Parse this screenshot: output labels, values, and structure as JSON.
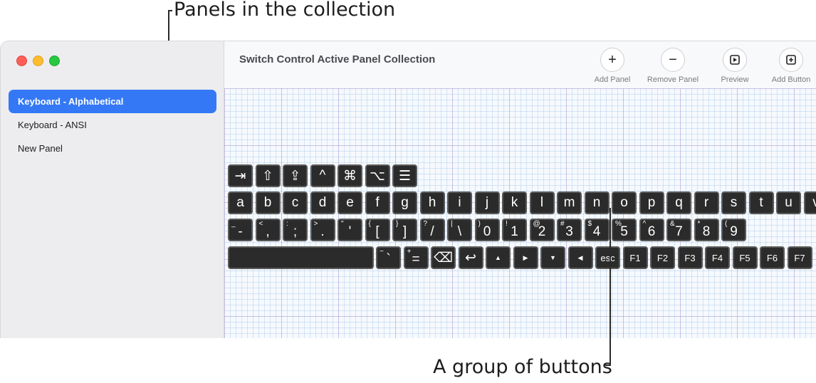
{
  "annotations": {
    "panels_label": "Panels in the collection",
    "buttons_label": "A group of buttons"
  },
  "window": {
    "title": "Switch Control Active Panel Collection"
  },
  "sidebar": {
    "items": [
      {
        "label": "Keyboard - Alphabetical",
        "selected": true
      },
      {
        "label": "Keyboard - ANSI",
        "selected": false
      },
      {
        "label": "New Panel",
        "selected": false
      }
    ]
  },
  "toolbar": {
    "add_panel": {
      "label": "Add Panel",
      "icon": "plus-icon"
    },
    "remove_panel": {
      "label": "Remove Panel",
      "icon": "minus-icon"
    },
    "preview": {
      "label": "Preview",
      "icon": "play-icon"
    },
    "add_button": {
      "label": "Add Button",
      "icon": "plus-square-icon"
    }
  },
  "keyboard": {
    "row1": [
      {
        "label": "⇥",
        "name": "tab-icon"
      },
      {
        "label": "⇧",
        "name": "shift-icon"
      },
      {
        "label": "⇪",
        "name": "caps-lock-icon"
      },
      {
        "label": "^",
        "name": "control-icon"
      },
      {
        "label": "⌘",
        "name": "command-icon"
      },
      {
        "label": "⌥",
        "name": "option-icon"
      },
      {
        "label": "☰",
        "name": "list-icon"
      }
    ],
    "row2": [
      "a",
      "b",
      "c",
      "d",
      "e",
      "f",
      "g",
      "h",
      "i",
      "j",
      "k",
      "l",
      "m",
      "n",
      "o",
      "p",
      "q",
      "r",
      "s",
      "t",
      "u",
      "v"
    ],
    "row3": [
      {
        "alt": "_",
        "main": "-"
      },
      {
        "alt": "<",
        "main": ","
      },
      {
        "alt": ":",
        "main": ";"
      },
      {
        "alt": ">",
        "main": "."
      },
      {
        "alt": "\"",
        "main": "'"
      },
      {
        "alt": "{",
        "main": "["
      },
      {
        "alt": "}",
        "main": "]"
      },
      {
        "alt": "?",
        "main": "/"
      },
      {
        "alt": "|",
        "main": "\\"
      },
      {
        "alt": ")",
        "main": "0"
      },
      {
        "alt": "!",
        "main": "1"
      },
      {
        "alt": "@",
        "main": "2"
      },
      {
        "alt": "#",
        "main": "3"
      },
      {
        "alt": "$",
        "main": "4"
      },
      {
        "alt": "%",
        "main": "5"
      },
      {
        "alt": "^",
        "main": "6"
      },
      {
        "alt": "&",
        "main": "7"
      },
      {
        "alt": "*",
        "main": "8"
      },
      {
        "alt": "(",
        "main": "9"
      }
    ],
    "row4": [
      {
        "label": "",
        "name": "space-key"
      },
      {
        "label": "`",
        "alt": "~",
        "name": "backtick-key"
      },
      {
        "label": "=",
        "alt": "+",
        "name": "equals-key"
      },
      {
        "label": "⌫",
        "name": "delete-icon"
      },
      {
        "label": "↩",
        "name": "return-icon"
      },
      {
        "label": "▲",
        "name": "arrow-up-icon"
      },
      {
        "label": "▶",
        "name": "arrow-right-icon"
      },
      {
        "label": "▼",
        "name": "arrow-down-icon"
      },
      {
        "label": "◀",
        "name": "arrow-left-icon"
      },
      {
        "label": "esc",
        "name": "esc-key"
      },
      {
        "label": "F1",
        "name": "f1-key"
      },
      {
        "label": "F2",
        "name": "f2-key"
      },
      {
        "label": "F3",
        "name": "f3-key"
      },
      {
        "label": "F4",
        "name": "f4-key"
      },
      {
        "label": "F5",
        "name": "f5-key"
      },
      {
        "label": "F6",
        "name": "f6-key"
      },
      {
        "label": "F7",
        "name": "f7-key"
      }
    ]
  }
}
